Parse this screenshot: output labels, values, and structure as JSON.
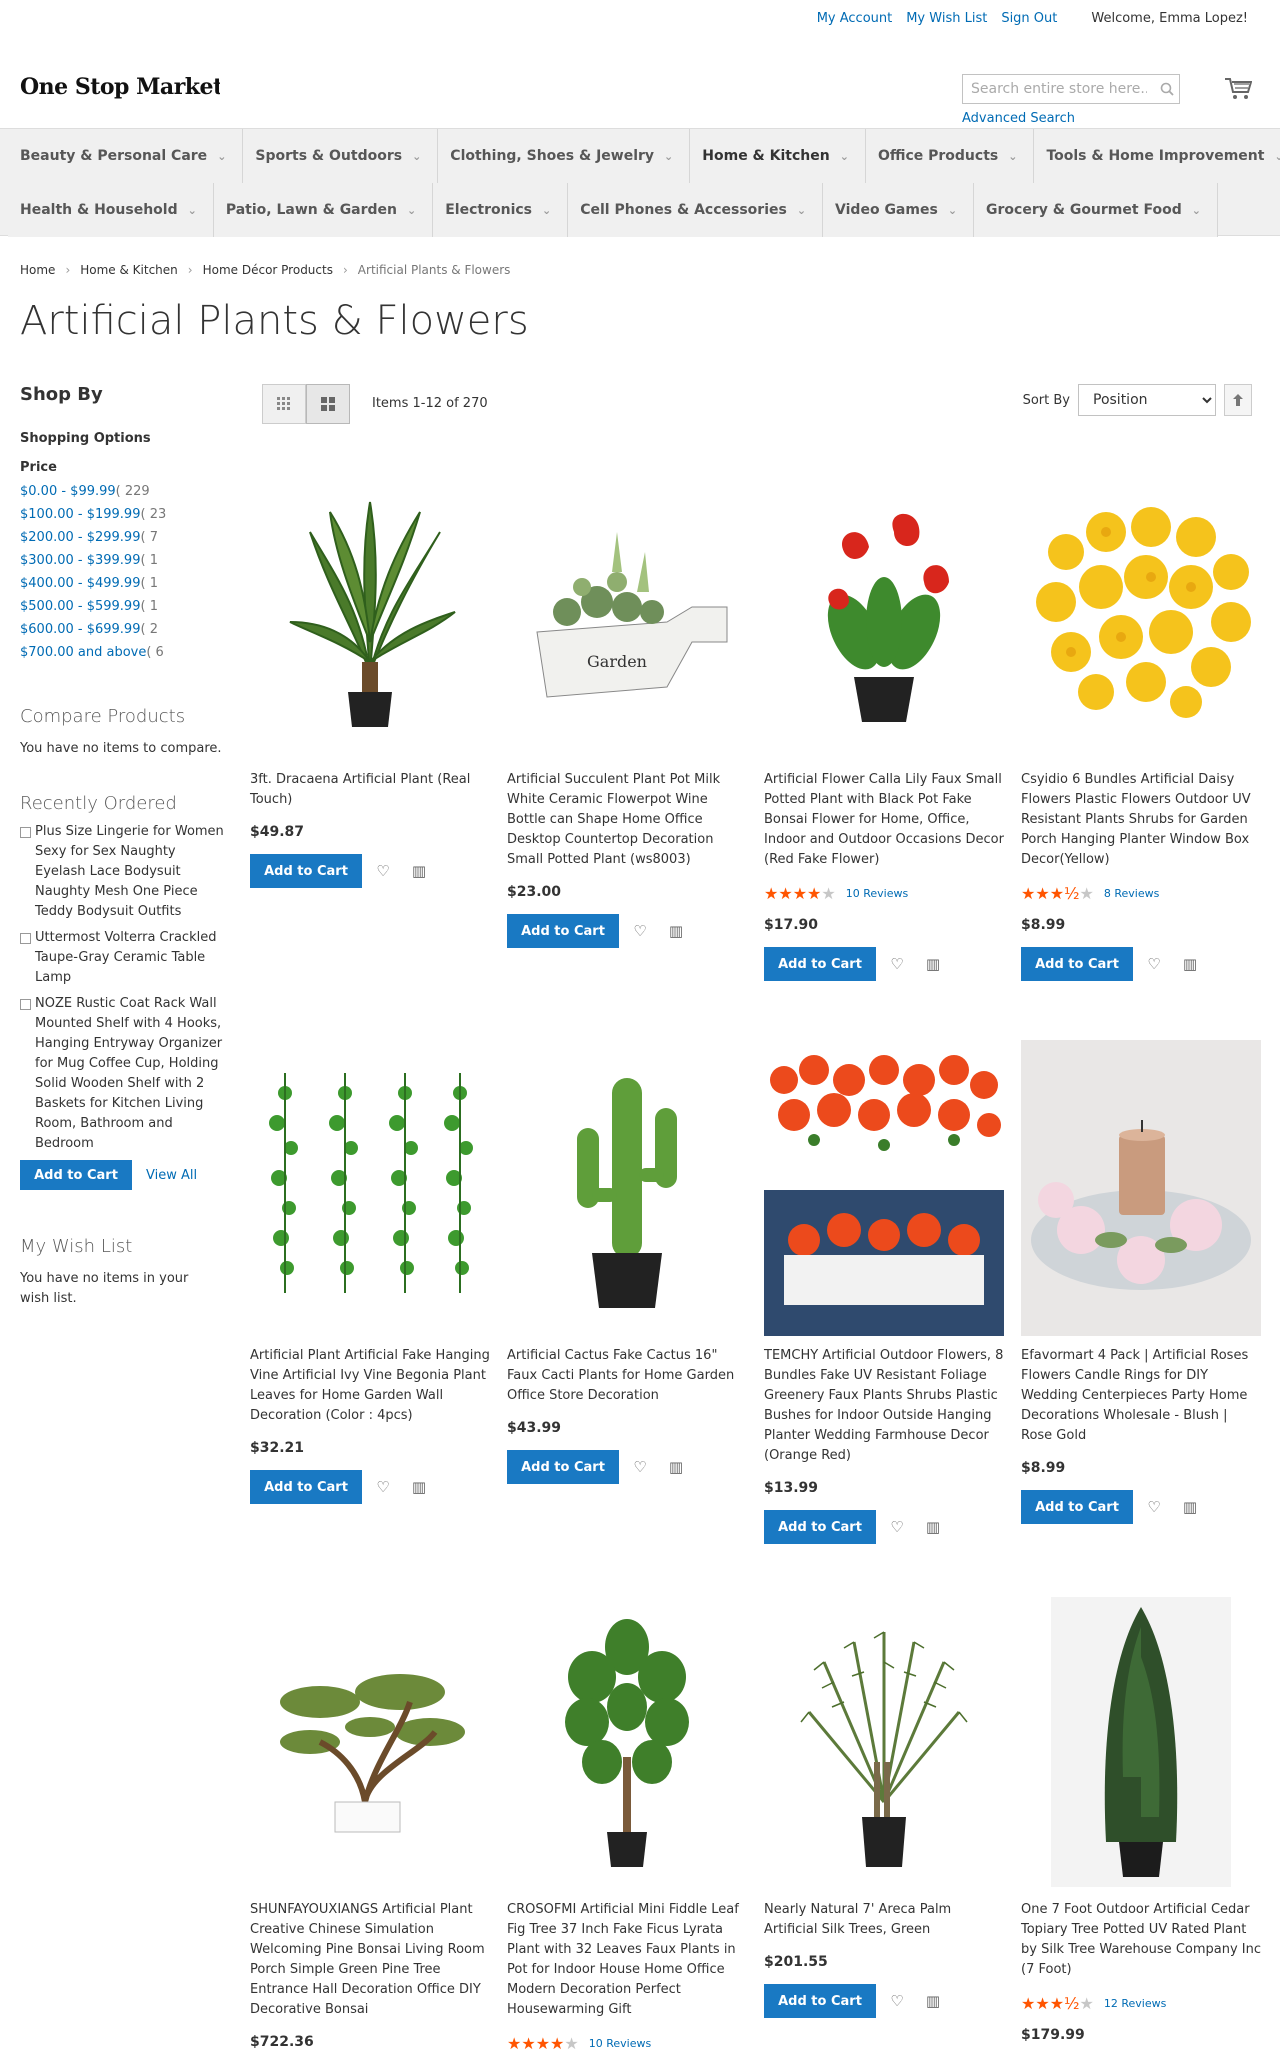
{
  "header": {
    "links": {
      "account": "My Account",
      "wishlist": "My Wish List",
      "signout": "Sign Out"
    },
    "welcome": "Welcome, Emma Lopez!",
    "logo": "One Stop Market",
    "search_placeholder": "Search entire store here...",
    "advanced_search": "Advanced Search"
  },
  "nav": {
    "row1": [
      "Beauty & Personal Care",
      "Sports & Outdoors",
      "Clothing, Shoes & Jewelry",
      "Home & Kitchen",
      "Office Products",
      "Tools & Home Improvement"
    ],
    "row2": [
      "Health & Household",
      "Patio, Lawn & Garden",
      "Electronics",
      "Cell Phones & Accessories",
      "Video Games",
      "Grocery & Gourmet Food"
    ]
  },
  "breadcrumb": {
    "home": "Home",
    "kitchen": "Home & Kitchen",
    "decor": "Home Décor Products",
    "current": "Artificial Plants & Flowers"
  },
  "page_title": "Artificial Plants & Flowers",
  "sidebar": {
    "shop_by": "Shop By",
    "shopping_options": "Shopping Options",
    "price_label": "Price",
    "prices": [
      {
        "range": "$0.00 - $99.99",
        "count": "( 229"
      },
      {
        "range": "$100.00 - $199.99",
        "count": "( 23"
      },
      {
        "range": "$200.00 - $299.99",
        "count": "( 7"
      },
      {
        "range": "$300.00 - $399.99",
        "count": "( 1"
      },
      {
        "range": "$400.00 - $499.99",
        "count": "( 1"
      },
      {
        "range": "$500.00 - $599.99",
        "count": "( 1"
      },
      {
        "range": "$600.00 - $699.99",
        "count": "( 2"
      },
      {
        "range": "$700.00 and above",
        "count": "( 6"
      }
    ],
    "compare_title": "Compare Products",
    "compare_text": "You have no items to compare.",
    "recent_title": "Recently Ordered",
    "recent_items": [
      "Plus Size Lingerie for Women Sexy for Sex Naughty Eyelash Lace Bodysuit Naughty Mesh One Piece Teddy Bodysuit Outfits",
      "Uttermost Volterra Crackled Taupe-Gray Ceramic Table Lamp",
      "NOZE Rustic Coat Rack Wall Mounted Shelf with 4 Hooks, Hanging Entryway Organizer for Mug Coffee Cup, Holding Solid Wooden Shelf with 2 Baskets for Kitchen Living Room, Bathroom and Bedroom"
    ],
    "add_to_cart": "Add to Cart",
    "view_all": "View All",
    "wishlist_title": "My Wish List",
    "wishlist_text": "You have no items in your wish list."
  },
  "toolbar": {
    "amount": "Items 1-12 of 270",
    "sort_by": "Sort By",
    "sort_value": "Position"
  },
  "products": [
    {
      "name": "3ft. Dracaena Artificial Plant (Real Touch)",
      "price": "$49.87",
      "rating": 0,
      "reviews": ""
    },
    {
      "name": "Artificial Succulent Plant Pot Milk White Ceramic Flowerpot Wine Bottle can Shape Home Office Desktop Countertop Decoration Small Potted Plant (ws8003)",
      "price": "$23.00",
      "rating": 0,
      "reviews": ""
    },
    {
      "name": "Artificial Flower Calla Lily Faux Small Potted Plant with Black Pot Fake Bonsai Flower for Home, Office, Indoor and Outdoor Occasions Decor (Red Fake Flower)",
      "price": "$17.90",
      "rating": 4,
      "reviews": "10  Reviews"
    },
    {
      "name": "Csyidio 6 Bundles Artificial Daisy Flowers Plastic Flowers Outdoor UV Resistant Plants Shrubs for Garden Porch Hanging Planter Window Box Decor(Yellow)",
      "price": "$8.99",
      "rating": 3.5,
      "reviews": "8  Reviews"
    },
    {
      "name": "Artificial Plant Artificial Fake Hanging Vine Artificial Ivy Vine Begonia Plant Leaves for Home Garden Wall Decoration (Color : 4pcs)",
      "price": "$32.21",
      "rating": 0,
      "reviews": ""
    },
    {
      "name": "Artificial Cactus Fake Cactus 16\" Faux Cacti Plants for Home Garden Office Store Decoration",
      "price": "$43.99",
      "rating": 0,
      "reviews": ""
    },
    {
      "name": "TEMCHY Artificial Outdoor Flowers, 8 Bundles Fake UV Resistant Foliage Greenery Faux Plants Shrubs Plastic Bushes for Indoor Outside Hanging Planter Wedding Farmhouse Decor (Orange Red)",
      "price": "$13.99",
      "rating": 0,
      "reviews": ""
    },
    {
      "name": "Efavormart 4 Pack | Artificial Roses Flowers Candle Rings for DIY Wedding Centerpieces Party Home Decorations Wholesale - Blush | Rose Gold",
      "price": "$8.99",
      "rating": 0,
      "reviews": ""
    },
    {
      "name": "SHUNFAYOUXIANGS Artificial Plant Creative Chinese Simulation Welcoming Pine Bonsai Living Room Porch Simple Green Pine Tree Entrance Hall Decoration Office DIY Decorative Bonsai",
      "price": "$722.36",
      "rating": 0,
      "reviews": ""
    },
    {
      "name": "CROSOFMI Artificial Mini Fiddle Leaf Fig Tree 37 Inch Fake Ficus Lyrata Plant with 32 Leaves Faux Plants in Pot for Indoor House Home Office Modern Decoration Perfect Housewarming Gift",
      "price": "",
      "rating": 4,
      "reviews": "10  Reviews"
    },
    {
      "name": "Nearly Natural 7' Areca Palm Artificial Silk Trees, Green",
      "price": "$201.55",
      "rating": 0,
      "reviews": ""
    },
    {
      "name": "One 7 Foot Outdoor Artificial Cedar Topiary Tree Potted UV Rated Plant by Silk Tree Warehouse Company Inc (7 Foot)",
      "price": "$179.99",
      "rating": 3.5,
      "reviews": "12  Reviews"
    }
  ],
  "icons": [
    "cart-icon",
    "search-icon",
    "grid-mode-icon",
    "list-mode-icon",
    "sort-direction-icon",
    "wishlist-heart-icon",
    "compare-icon"
  ],
  "colors": {
    "link": "#006bb4",
    "button": "#1979c3",
    "star": "#ff5501",
    "nav_bg": "#f0f0f0"
  }
}
